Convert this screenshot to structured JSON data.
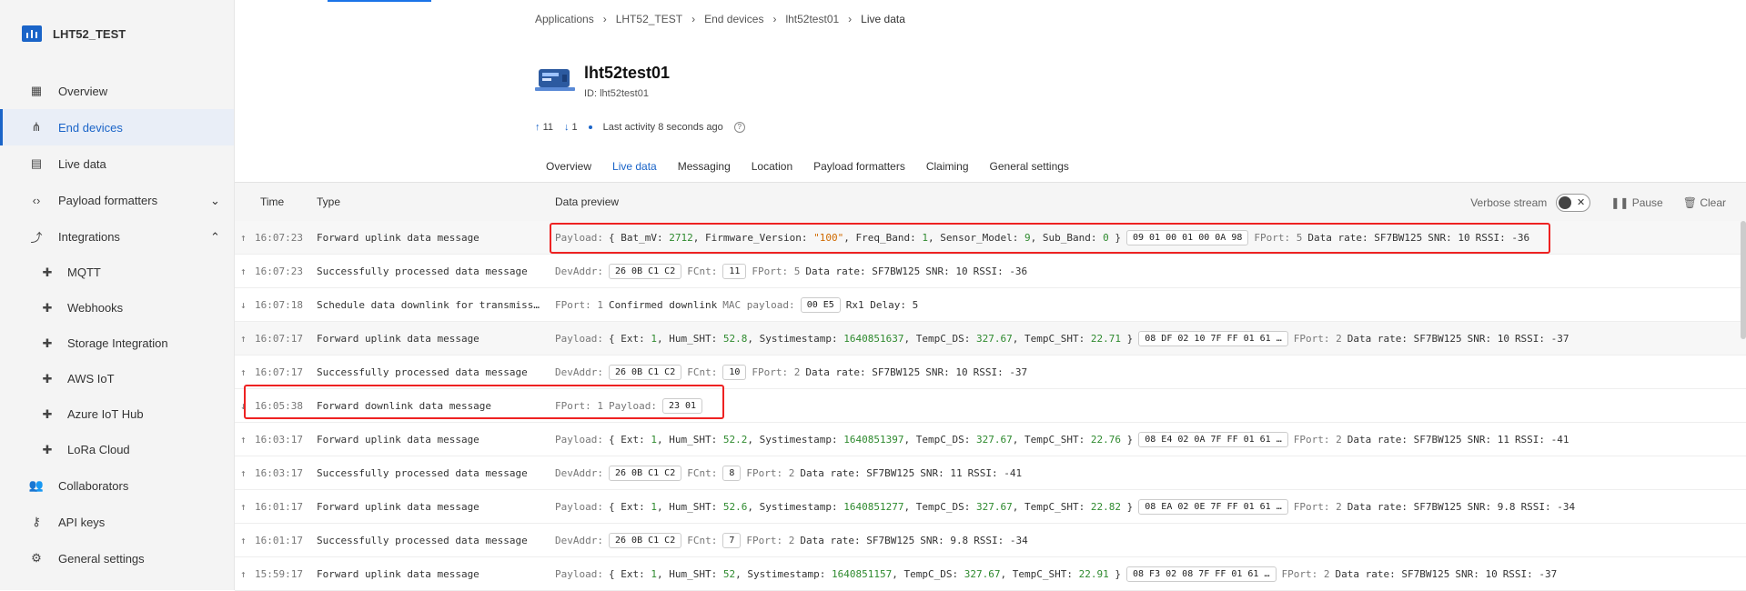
{
  "app": {
    "title": "LHT52_TEST"
  },
  "sidebar": {
    "items": [
      {
        "label": "Overview",
        "icon": "grid-icon"
      },
      {
        "label": "End devices",
        "icon": "devices-icon",
        "active": true
      },
      {
        "label": "Live data",
        "icon": "chart-icon"
      },
      {
        "label": "Payload formatters",
        "icon": "code-icon"
      },
      {
        "label": "Integrations",
        "icon": "fork-icon"
      },
      {
        "label": "MQTT",
        "icon": "puzzle-icon",
        "sub": true
      },
      {
        "label": "Webhooks",
        "icon": "puzzle-icon",
        "sub": true
      },
      {
        "label": "Storage Integration",
        "icon": "puzzle-icon",
        "sub": true
      },
      {
        "label": "AWS IoT",
        "icon": "puzzle-icon",
        "sub": true
      },
      {
        "label": "Azure IoT Hub",
        "icon": "puzzle-icon",
        "sub": true
      },
      {
        "label": "LoRa Cloud",
        "icon": "puzzle-icon",
        "sub": true
      },
      {
        "label": "Collaborators",
        "icon": "people-icon"
      },
      {
        "label": "API keys",
        "icon": "key-icon"
      },
      {
        "label": "General settings",
        "icon": "gear-icon"
      }
    ]
  },
  "breadcrumb": [
    "Applications",
    "LHT52_TEST",
    "End devices",
    "lht52test01",
    "Live data"
  ],
  "device": {
    "name": "lht52test01",
    "id_label": "ID: lht52test01"
  },
  "stats": {
    "uplinks": "11",
    "downlinks": "1",
    "activity": "Last activity 8 seconds ago"
  },
  "tabs": [
    "Overview",
    "Live data",
    "Messaging",
    "Location",
    "Payload formatters",
    "Claiming",
    "General settings"
  ],
  "table": {
    "headers": {
      "time": "Time",
      "type": "Type",
      "preview": "Data preview"
    },
    "controls": {
      "verbose": "Verbose stream",
      "pause": "Pause",
      "clear": "Clear"
    },
    "rows": [
      {
        "dir": "up",
        "time": "16:07:23",
        "type": "Forward uplink data message",
        "kind": "uplink",
        "payload": "{ Bat_mV: 2712, Firmware_Version: \"100\", Freq_Band: 1, Sensor_Model: 9, Sub_Band: 0 }",
        "hex": "09 01 00 01 00 0A 98",
        "fport": "FPort: 5",
        "rate": "Data rate: SF7BW125",
        "snr": "SNR: 10",
        "rssi": "RSSI: -36"
      },
      {
        "dir": "up",
        "time": "16:07:23",
        "type": "Successfully processed data message",
        "kind": "processed",
        "devaddr": "26 0B C1 C2",
        "fcnt": "11",
        "fport": "FPort: 5",
        "rate": "Data rate: SF7BW125",
        "snr": "SNR: 10",
        "rssi": "RSSI: -36"
      },
      {
        "dir": "down",
        "time": "16:07:18",
        "type": "Schedule data downlink for transmissi…",
        "kind": "schedule",
        "fport": "FPort: 1",
        "confirmed": "Confirmed downlink",
        "mac": "00 E5",
        "rx1": "Rx1 Delay: 5"
      },
      {
        "dir": "up",
        "time": "16:07:17",
        "type": "Forward uplink data message",
        "kind": "uplink",
        "payload": "{ Ext: 1, Hum_SHT: 52.8, Systimestamp: 1640851637, TempC_DS: 327.67, TempC_SHT: 22.71 }",
        "hex": "08 DF 02 10 7F FF 01 61 …",
        "fport": "FPort: 2",
        "rate": "Data rate: SF7BW125",
        "snr": "SNR: 10",
        "rssi": "RSSI: -37"
      },
      {
        "dir": "up",
        "time": "16:07:17",
        "type": "Successfully processed data message",
        "kind": "processed",
        "devaddr": "26 0B C1 C2",
        "fcnt": "10",
        "fport": "FPort: 2",
        "rate": "Data rate: SF7BW125",
        "snr": "SNR: 10",
        "rssi": "RSSI: -37"
      },
      {
        "dir": "down",
        "time": "16:05:38",
        "type": "Forward downlink data message",
        "kind": "downlink",
        "fport": "FPort: 1",
        "payload_hex": "23 01"
      },
      {
        "dir": "up",
        "time": "16:03:17",
        "type": "Forward uplink data message",
        "kind": "uplink",
        "payload": "{ Ext: 1, Hum_SHT: 52.2, Systimestamp: 1640851397, TempC_DS: 327.67, TempC_SHT: 22.76 }",
        "hex": "08 E4 02 0A 7F FF 01 61 …",
        "fport": "FPort: 2",
        "rate": "Data rate: SF7BW125",
        "snr": "SNR: 11",
        "rssi": "RSSI: -41"
      },
      {
        "dir": "up",
        "time": "16:03:17",
        "type": "Successfully processed data message",
        "kind": "processed",
        "devaddr": "26 0B C1 C2",
        "fcnt": "8",
        "fport": "FPort: 2",
        "rate": "Data rate: SF7BW125",
        "snr": "SNR: 11",
        "rssi": "RSSI: -41"
      },
      {
        "dir": "up",
        "time": "16:01:17",
        "type": "Forward uplink data message",
        "kind": "uplink",
        "payload": "{ Ext: 1, Hum_SHT: 52.6, Systimestamp: 1640851277, TempC_DS: 327.67, TempC_SHT: 22.82 }",
        "hex": "08 EA 02 0E 7F FF 01 61 …",
        "fport": "FPort: 2",
        "rate": "Data rate: SF7BW125",
        "snr": "SNR: 9.8",
        "rssi": "RSSI: -34"
      },
      {
        "dir": "up",
        "time": "16:01:17",
        "type": "Successfully processed data message",
        "kind": "processed",
        "devaddr": "26 0B C1 C2",
        "fcnt": "7",
        "fport": "FPort: 2",
        "rate": "Data rate: SF7BW125",
        "snr": "SNR: 9.8",
        "rssi": "RSSI: -34"
      },
      {
        "dir": "up",
        "time": "15:59:17",
        "type": "Forward uplink data message",
        "kind": "uplink",
        "payload": "{ Ext: 1, Hum_SHT: 52, Systimestamp: 1640851157, TempC_DS: 327.67, TempC_SHT: 22.91 }",
        "hex": "08 F3 02 08 7F FF 01 61 …",
        "fport": "FPort: 2",
        "rate": "Data rate: SF7BW125",
        "snr": "SNR: 10",
        "rssi": "RSSI: -37"
      }
    ]
  },
  "colors": {
    "accent": "#1a64c8",
    "highlight": "#e22222",
    "number": "#2f8a2f",
    "string": "#d06a00"
  }
}
